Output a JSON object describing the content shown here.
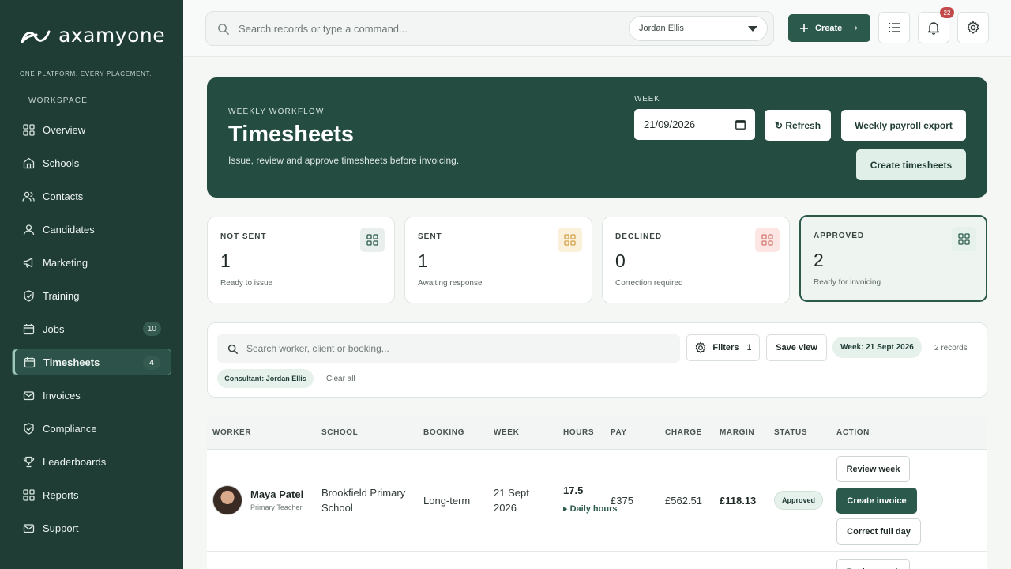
{
  "brand": {
    "name": "axamyone",
    "tagline": "ONE PLATFORM. EVERY PLACEMENT."
  },
  "sidebar": {
    "section": "WORKSPACE",
    "items": [
      {
        "label": "Overview",
        "icon": "grid-icon"
      },
      {
        "label": "Schools",
        "icon": "school-icon"
      },
      {
        "label": "Contacts",
        "icon": "contacts-icon"
      },
      {
        "label": "Candidates",
        "icon": "user-icon"
      },
      {
        "label": "Marketing",
        "icon": "megaphone-icon"
      },
      {
        "label": "Training",
        "icon": "shield-icon"
      },
      {
        "label": "Jobs",
        "icon": "calendar-icon",
        "badge": "10"
      },
      {
        "label": "Timesheets",
        "icon": "calendar-icon",
        "badge": "4",
        "active": true
      },
      {
        "label": "Invoices",
        "icon": "mail-icon"
      },
      {
        "label": "Compliance",
        "icon": "shield-icon"
      },
      {
        "label": "Leaderboards",
        "icon": "trophy-icon"
      },
      {
        "label": "Reports",
        "icon": "grid-icon"
      },
      {
        "label": "Support",
        "icon": "mail-icon"
      }
    ]
  },
  "topbar": {
    "search_placeholder": "Search records or type a command...",
    "user": "Jordan Ellis",
    "create_label": "Create",
    "notif_count": "22"
  },
  "hero": {
    "eyebrow": "WEEKLY WORKFLOW",
    "title": "Timesheets",
    "subtitle": "Issue, review and approve timesheets before invoicing.",
    "week_label": "WEEK",
    "week_value": "21/09/2026",
    "refresh_label": "↻ Refresh",
    "export_label": "Weekly payroll export",
    "create_label": "Create timesheets"
  },
  "stats": [
    {
      "label": "NOT SENT",
      "value": "1",
      "sub": "Ready to issue",
      "color": "#2b5a4c",
      "bg": "#e9efec"
    },
    {
      "label": "SENT",
      "value": "1",
      "sub": "Awaiting response",
      "color": "#d3a24a",
      "bg": "#fbf0d9"
    },
    {
      "label": "DECLINED",
      "value": "0",
      "sub": "Correction required",
      "color": "#d47a72",
      "bg": "#fbe6e4"
    },
    {
      "label": "APPROVED",
      "value": "2",
      "sub": "Ready for invoicing",
      "color": "#2b5a4c",
      "bg": "#e6f1ec"
    }
  ],
  "filters": {
    "search_placeholder": "Search worker, client or booking...",
    "filters_label": "Filters",
    "filters_count": "1",
    "save_view": "Save view",
    "week_chip": "Week: 21 Sept 2026",
    "records": "2 records",
    "consultant_chip": "Consultant: Jordan Ellis",
    "clear_all": "Clear all"
  },
  "table": {
    "headers": [
      "WORKER",
      "SCHOOL",
      "BOOKING",
      "WEEK",
      "HOURS",
      "PAY",
      "CHARGE",
      "MARGIN",
      "STATUS",
      "ACTION"
    ],
    "rows": [
      {
        "worker": "Maya Patel",
        "role": "Primary Teacher",
        "school_l1": "Brookfield Primary",
        "school_l2": "School",
        "booking": "Long-term",
        "week_l1": "21 Sept",
        "week_l2": "2026",
        "hours": "17.5",
        "hours_toggle": "▸ Daily hours",
        "pay": "£375",
        "charge": "£562.51",
        "margin": "£118.13",
        "status": "Approved",
        "actions": [
          "Review week",
          "Create invoice",
          "Correct full day"
        ]
      }
    ],
    "next_row_action": "Review week"
  }
}
